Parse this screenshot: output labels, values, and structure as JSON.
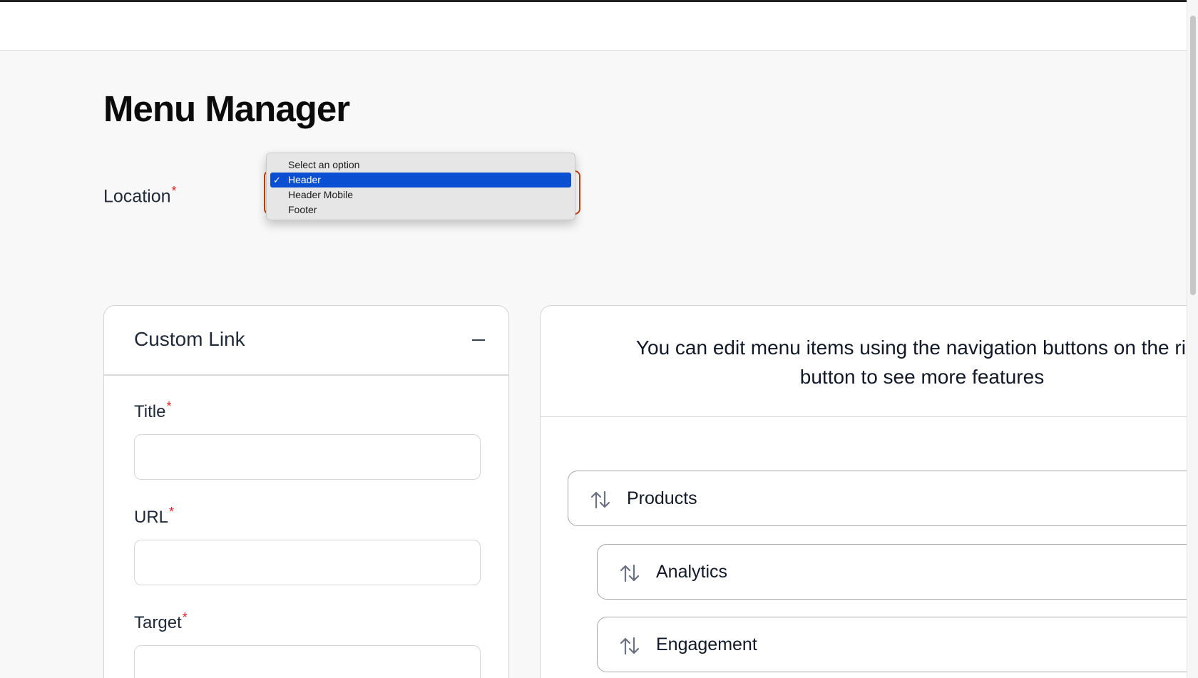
{
  "page": {
    "title": "Menu Manager"
  },
  "location": {
    "label": "Location",
    "required_mark": "*",
    "options": [
      "Select an option",
      "Header",
      "Header Mobile",
      "Footer"
    ],
    "selected": "Header",
    "check_mark": "✓"
  },
  "custom_link": {
    "title": "Custom Link",
    "collapse_icon": "minus-icon",
    "fields": {
      "title": {
        "label": "Title",
        "value": ""
      },
      "url": {
        "label": "URL",
        "value": ""
      },
      "target": {
        "label": "Target"
      }
    },
    "required_mark": "*"
  },
  "menu_structure": {
    "help_line1": "You can edit menu items using the navigation buttons on the righ",
    "help_line2": "button to see more features",
    "items": [
      {
        "label": "Products",
        "icon": "arrows-up-down-icon",
        "depth": 0
      },
      {
        "label": "Analytics",
        "icon": "arrows-up-down-icon",
        "depth": 1
      },
      {
        "label": "Engagement",
        "icon": "arrows-up-down-icon",
        "depth": 1
      }
    ]
  },
  "colors": {
    "accent_focus": "#c2410c",
    "dropdown_selected": "#0a4fd1",
    "required": "#e02424"
  }
}
